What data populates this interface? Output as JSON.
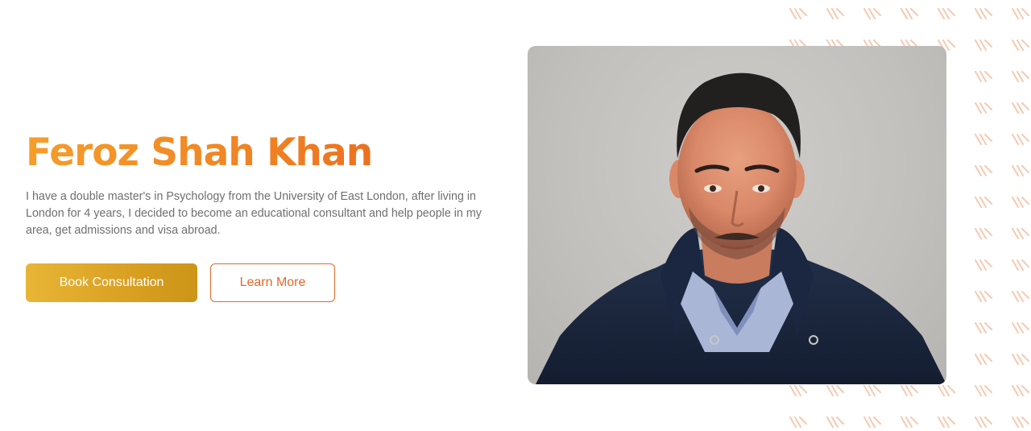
{
  "hero": {
    "title": "Feroz Shah Khan",
    "description": "I have a double master's in Psychology from the University of East London, after living in London for 4 years, I decided to become an educational consultant and help people in my area, get admissions and visa abroad.",
    "primary_button": "Book Consultation",
    "secondary_button": "Learn More"
  },
  "photo": {
    "alt": "Feroz Shah Khan"
  },
  "colors": {
    "title_gradient_start": "#f59e2b",
    "title_gradient_end": "#e4591d",
    "primary_button": "#d9a021",
    "outline_accent": "#e0692b",
    "body_text": "#6f6f6f",
    "pattern": "#f6c9b0"
  },
  "icons": {
    "pattern": "chevron-stripe-pattern"
  }
}
